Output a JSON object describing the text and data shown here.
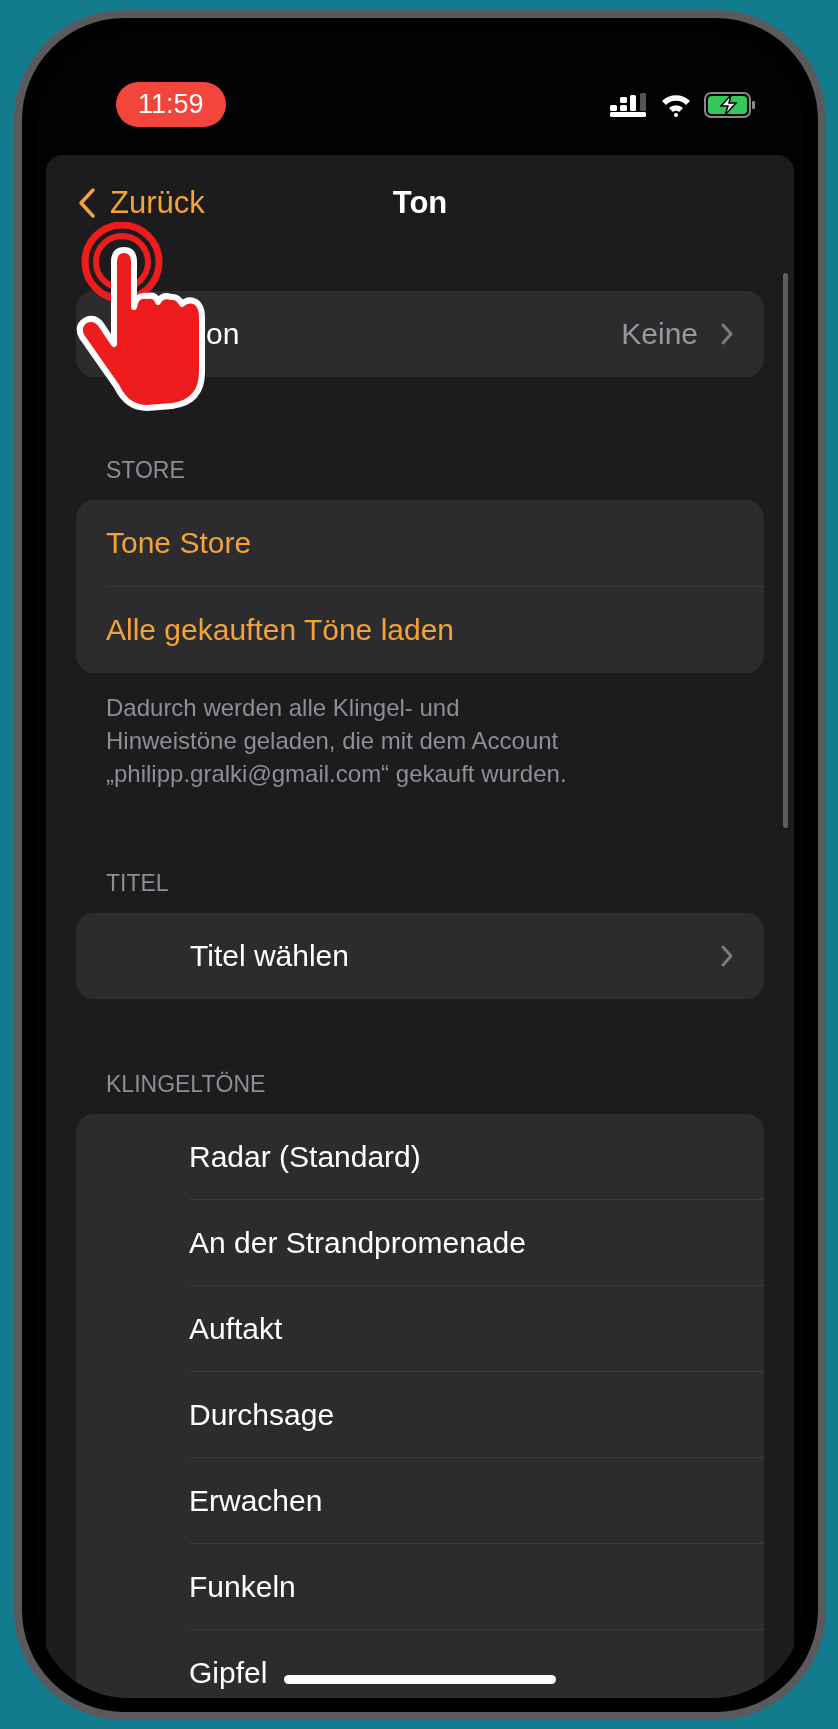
{
  "status_bar": {
    "time": "11:59"
  },
  "nav": {
    "back": "Zurück",
    "title": "Ton"
  },
  "vibration": {
    "label": "on",
    "value": "Keine"
  },
  "store": {
    "header": "STORE",
    "items": [
      "Tone Store",
      "Alle gekauften Töne laden"
    ],
    "footer": "Dadurch werden alle Klingel- und Hinweistöne geladen, die mit dem Account „philipp.gralki@gmail.com“ gekauft wurden."
  },
  "titel": {
    "header": "TITEL",
    "item": "Titel wählen"
  },
  "ringtones": {
    "header": "KLINGELTÖNE",
    "items": [
      "Radar (Standard)",
      "An der Strandpromenade",
      "Auftakt",
      "Durchsage",
      "Erwachen",
      "Funkeln",
      "Gipfel"
    ]
  }
}
